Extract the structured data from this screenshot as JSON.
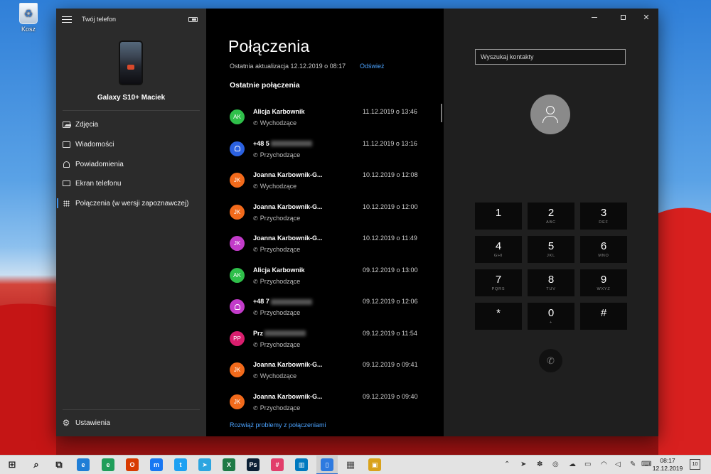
{
  "desktop": {
    "recycle_bin_label": "Kosz"
  },
  "app": {
    "title": "Twój telefon",
    "device_name": "Galaxy S10+ Maciek",
    "nav": [
      {
        "label": "Zdjęcia",
        "icon": "photos-icon"
      },
      {
        "label": "Wiadomości",
        "icon": "messages-icon"
      },
      {
        "label": "Powiadomienia",
        "icon": "bell-icon"
      },
      {
        "label": "Ekran telefonu",
        "icon": "phone-screen-icon"
      },
      {
        "label": "Połączenia (w wersji zapoznawczej)",
        "icon": "keypad-icon",
        "active": true
      }
    ],
    "settings_label": "Ustawienia"
  },
  "calls": {
    "title": "Połączenia",
    "last_update": "Ostatnia aktualizacja 12.12.2019 o 08:17",
    "refresh_label": "Odśwież",
    "recent_heading": "Ostatnie połączenia",
    "items": [
      {
        "initials": "AK",
        "color": "#2fbf4a",
        "name": "Alicja Karbownik",
        "direction": "Wychodzące",
        "time": "11.12.2019 o 13:46"
      },
      {
        "initials": "",
        "color": "#2b61e0",
        "name": "+48 5",
        "name_blurred": true,
        "direction": "Przychodzące",
        "time": "11.12.2019 o 13:16"
      },
      {
        "initials": "JK",
        "color": "#f26a1b",
        "name": "Joanna Karbownik-G...",
        "direction": "Wychodzące",
        "time": "10.12.2019 o 12:08"
      },
      {
        "initials": "JK",
        "color": "#f26a1b",
        "name": "Joanna Karbownik-G...",
        "direction": "Przychodzące",
        "time": "10.12.2019 o 12:00"
      },
      {
        "initials": "JK",
        "color": "#c23bc9",
        "name": "Joanna Karbownik-G...",
        "direction": "Przychodzące",
        "time": "10.12.2019 o 11:49"
      },
      {
        "initials": "AK",
        "color": "#2fbf4a",
        "name": "Alicja Karbownik",
        "direction": "Przychodzące",
        "time": "09.12.2019 o 13:00"
      },
      {
        "initials": "",
        "color": "#c23bc9",
        "name": "+48 7",
        "name_blurred": true,
        "direction": "Przychodzące",
        "time": "09.12.2019 o 12:06"
      },
      {
        "initials": "PP",
        "color": "#d91e6e",
        "name": "Prz",
        "name_blurred": true,
        "direction": "Przychodzące",
        "time": "09.12.2019 o 11:54"
      },
      {
        "initials": "JK",
        "color": "#f26a1b",
        "name": "Joanna Karbownik-G...",
        "direction": "Wychodzące",
        "time": "09.12.2019 o 09:41"
      },
      {
        "initials": "JK",
        "color": "#f26a1b",
        "name": "Joanna Karbownik-G...",
        "direction": "Przychodzące",
        "time": "09.12.2019 o 09:40"
      }
    ],
    "troubleshoot_link": "Rozwiąż problemy z połączeniami"
  },
  "dialer": {
    "search_placeholder": "Wyszukaj kontakty",
    "keys": [
      {
        "digit": "1",
        "letters": ""
      },
      {
        "digit": "2",
        "letters": "ABC"
      },
      {
        "digit": "3",
        "letters": "DEF"
      },
      {
        "digit": "4",
        "letters": "GHI"
      },
      {
        "digit": "5",
        "letters": "JKL"
      },
      {
        "digit": "6",
        "letters": "MNO"
      },
      {
        "digit": "7",
        "letters": "PQRS"
      },
      {
        "digit": "8",
        "letters": "TUV"
      },
      {
        "digit": "9",
        "letters": "WXYZ"
      },
      {
        "digit": "*",
        "letters": ""
      },
      {
        "digit": "0",
        "letters": "+"
      },
      {
        "digit": "#",
        "letters": ""
      }
    ]
  },
  "taskbar": {
    "apps": [
      {
        "name": "windows-start-icon",
        "glyph": "⊞",
        "color": "#1a1a1a"
      },
      {
        "name": "search-icon",
        "glyph": "⌕",
        "color": "#1a1a1a"
      },
      {
        "name": "task-view-icon",
        "glyph": "⧉",
        "color": "#1a1a1a"
      },
      {
        "name": "edge-icon",
        "glyph": "e",
        "color": "#1f7ed6"
      },
      {
        "name": "edge-beta-icon",
        "glyph": "e",
        "color": "#1f9e5a"
      },
      {
        "name": "office-icon",
        "glyph": "O",
        "color": "#d83b01"
      },
      {
        "name": "messenger-icon",
        "glyph": "m",
        "color": "#1877f2"
      },
      {
        "name": "twitter-icon",
        "glyph": "t",
        "color": "#1da1f2"
      },
      {
        "name": "telegram-icon",
        "glyph": "➤",
        "color": "#2ca5e0"
      },
      {
        "name": "excel-icon",
        "glyph": "X",
        "color": "#1d7a45"
      },
      {
        "name": "photoshop-icon",
        "glyph": "Ps",
        "color": "#0b1f35"
      },
      {
        "name": "slack-icon",
        "glyph": "#",
        "color": "#e23e6b"
      },
      {
        "name": "trello-icon",
        "glyph": "▥",
        "color": "#0079bf"
      },
      {
        "name": "your-phone-icon",
        "glyph": "▯",
        "color": "#2d7ae0"
      },
      {
        "name": "calculator-icon",
        "glyph": "▦",
        "color": "#4a4a4a"
      },
      {
        "name": "store-icon",
        "glyph": "▣",
        "color": "#d9a21b"
      }
    ],
    "tray": [
      {
        "name": "chevron-up-icon",
        "glyph": "⌃"
      },
      {
        "name": "telegram-tray-icon",
        "glyph": "➤"
      },
      {
        "name": "app-tray-icon",
        "glyph": "✽"
      },
      {
        "name": "messenger-tray-icon",
        "glyph": "◎"
      },
      {
        "name": "cloud-icon",
        "glyph": "☁"
      },
      {
        "name": "battery-tray-icon",
        "glyph": "▭"
      },
      {
        "name": "wifi-icon",
        "glyph": "◠"
      },
      {
        "name": "volume-icon",
        "glyph": "◁"
      },
      {
        "name": "pen-icon",
        "glyph": "✎"
      },
      {
        "name": "keyboard-icon",
        "glyph": "⌨"
      }
    ],
    "time": "08:17",
    "date": "12.12.2019",
    "notification_count": "10"
  }
}
